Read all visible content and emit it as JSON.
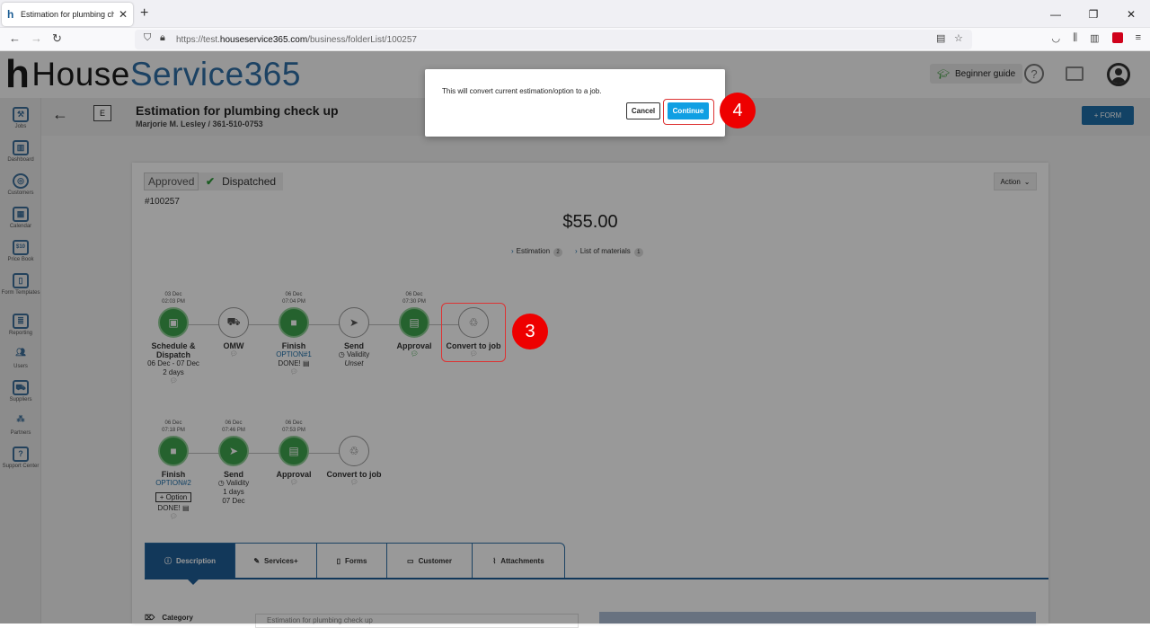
{
  "browser": {
    "tab_title": "Estimation for plumbing check up",
    "new_tab": "+",
    "url_prefix": "https://test.",
    "url_domain": "houseservice365.com",
    "url_path": "/business/folderList/100257"
  },
  "header": {
    "logo_part1": "House",
    "logo_part2": "Service365",
    "beginner_guide": "Beginner guide"
  },
  "sidebar": {
    "items": [
      {
        "label": "Jobs",
        "icon": "tools-icon"
      },
      {
        "label": "Dashboard",
        "icon": "chart-icon"
      },
      {
        "label": "Customers",
        "icon": "target-icon"
      },
      {
        "label": "Calendar",
        "icon": "calendar-icon"
      },
      {
        "label": "Price Book",
        "icon": "pricebook-icon"
      },
      {
        "label": "Form Templates",
        "icon": "form-icon"
      },
      {
        "label": "Reporting",
        "icon": "report-icon"
      },
      {
        "label": "Users",
        "icon": "users-icon"
      },
      {
        "label": "Suppliers",
        "icon": "truck-icon"
      },
      {
        "label": "Partners",
        "icon": "partners-icon"
      },
      {
        "label": "Support Center",
        "icon": "support-icon"
      }
    ]
  },
  "page": {
    "badge": "E",
    "title": "Estimation for plumbing check up",
    "subtitle": "Marjorie M. Lesley / 361-510-0753",
    "form_button": "+ FORM"
  },
  "card": {
    "status_approved": "Approved",
    "status_dispatched": "Dispatched",
    "number": "#100257",
    "action": "Action",
    "price": "$55.00",
    "link_estimation": "Estimation",
    "link_estimation_count": "2",
    "link_materials": "List of materials",
    "link_materials_count": "1"
  },
  "workflow1": [
    {
      "date": "03 Dec",
      "time": "02:03 PM",
      "label": "Schedule &",
      "label2": "Dispatch",
      "sub1": "06 Dec - 07 Dec",
      "sub2": "2 days",
      "state": "green"
    },
    {
      "date": "",
      "time": "",
      "label": "OMW",
      "state": "white"
    },
    {
      "date": "06 Dec",
      "time": "07:04 PM",
      "label": "Finish",
      "opt": "OPTION#1",
      "sub1": "DONE!",
      "state": "green"
    },
    {
      "date": "",
      "time": "",
      "label": "Send",
      "sub1": "Validity",
      "sub2": "Unset",
      "state": "white"
    },
    {
      "date": "06 Dec",
      "time": "07:30 PM",
      "label": "Approval",
      "state": "green"
    },
    {
      "date": "",
      "time": "",
      "label": "Convert to job",
      "state": "white"
    }
  ],
  "workflow2": [
    {
      "date": "06 Dec",
      "time": "07:18 PM",
      "label": "Finish",
      "opt": "OPTION#2",
      "optbtn": "+ Option",
      "sub1": "DONE!",
      "state": "green"
    },
    {
      "date": "06 Dec",
      "time": "07:46 PM",
      "label": "Send",
      "sub1": "Validity",
      "sub2": "1 days",
      "sub3": "07 Dec",
      "state": "green"
    },
    {
      "date": "06 Dec",
      "time": "07:53 PM",
      "label": "Approval",
      "state": "green"
    },
    {
      "date": "",
      "time": "",
      "label": "Convert to job",
      "state": "white"
    }
  ],
  "tabs": [
    {
      "label": "Description"
    },
    {
      "label": "Services+"
    },
    {
      "label": "Forms"
    },
    {
      "label": "Customer"
    },
    {
      "label": "Attachments"
    }
  ],
  "category": {
    "label": "Category",
    "value": "Estimation for plumbing check up"
  },
  "dialog": {
    "message": "This will convert current estimation/option to a job.",
    "cancel": "Cancel",
    "continue": "Continue"
  },
  "annotations": {
    "step3": "3",
    "step4": "4",
    "color": "#e00000"
  }
}
